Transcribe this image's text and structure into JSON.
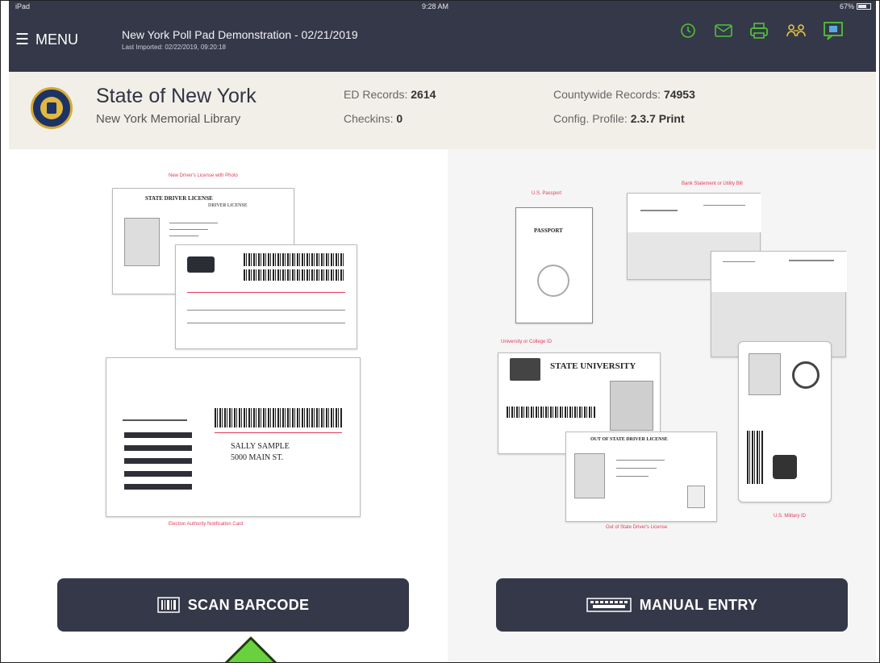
{
  "status_bar": {
    "left": "iPad",
    "time": "9:28 AM",
    "battery": "67%"
  },
  "header": {
    "menu_label": "MENU",
    "title": "New York Poll Pad Demonstration - 02/21/2019",
    "subtitle": "Last Imported: 02/22/2019, 09:20:18",
    "icons": [
      "history-icon",
      "message-icon",
      "printer-icon",
      "users-icon",
      "chat-icon"
    ]
  },
  "info": {
    "state": "State of New York",
    "location": "New York Memorial Library",
    "ed_label": "ED Records:",
    "ed_value": "2614",
    "checkins_label": "Checkins:",
    "checkins_value": "0",
    "county_label": "Countywide Records:",
    "county_value": "74953",
    "profile_label": "Config. Profile:",
    "profile_value": "2.3.7 Print"
  },
  "left_panel": {
    "caption_license": "New Driver's License with Photo",
    "license_title": "STATE DRIVER LICENSE",
    "license_sub": "DRIVER LICENSE",
    "card_name": "SALLY SAMPLE",
    "card_address": "5000 MAIN ST.",
    "caption_card": "Election Authority Notification Card"
  },
  "right_panel": {
    "caption_passport": "U.S. Passport",
    "passport_label": "PASSPORT",
    "caption_bank": "Bank Statement or Utility Bill",
    "caption_university": "University or College ID",
    "university_label": "STATE UNIVERSITY",
    "oos_title": "OUT OF STATE DRIVER LICENSE",
    "caption_oos": "Out of State Driver's License",
    "caption_military": "U.S. Military ID"
  },
  "buttons": {
    "scan": "SCAN BARCODE",
    "manual": "MANUAL ENTRY"
  },
  "colors": {
    "header": "#353848",
    "band": "#f1efe7",
    "caption": "#e23b5a",
    "arrow": "#6ad13e",
    "icon_green": "#4fc23a",
    "icon_yellow": "#e2c43b",
    "icon_blue": "#5aa8e0"
  }
}
